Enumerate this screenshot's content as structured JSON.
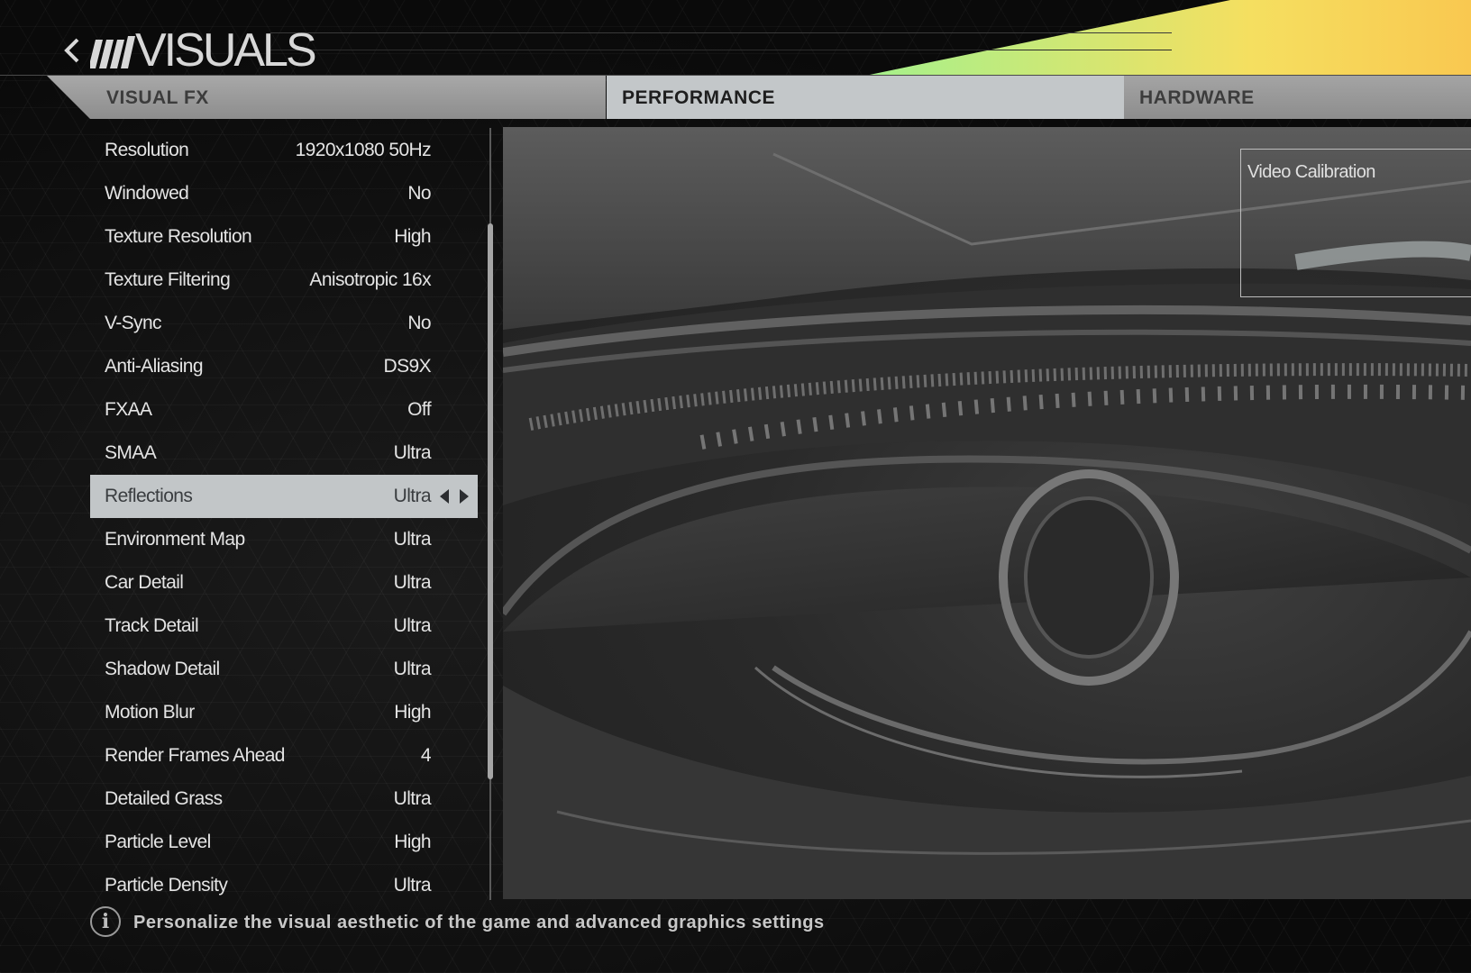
{
  "header": {
    "title": "VISUALS",
    "accent_gradient": [
      "#e0306a",
      "#3ef0a0",
      "#f9c850"
    ]
  },
  "tabs": [
    {
      "label": "VISUAL FX",
      "active": false
    },
    {
      "label": "PERFORMANCE",
      "active": true
    },
    {
      "label": "HARDWARE",
      "active": false
    }
  ],
  "settings": [
    {
      "label": "Resolution",
      "value": "1920x1080 50Hz"
    },
    {
      "label": "Windowed",
      "value": "No"
    },
    {
      "label": "Texture Resolution",
      "value": "High"
    },
    {
      "label": "Texture Filtering",
      "value": "Anisotropic 16x"
    },
    {
      "label": "V-Sync",
      "value": "No"
    },
    {
      "label": "Anti-Aliasing",
      "value": "DS9X"
    },
    {
      "label": "FXAA",
      "value": "Off"
    },
    {
      "label": "SMAA",
      "value": "Ultra"
    },
    {
      "label": "Reflections",
      "value": "Ultra",
      "selected": true
    },
    {
      "label": "Environment Map",
      "value": "Ultra"
    },
    {
      "label": "Car Detail",
      "value": "Ultra"
    },
    {
      "label": "Track Detail",
      "value": "Ultra"
    },
    {
      "label": "Shadow Detail",
      "value": "Ultra"
    },
    {
      "label": "Motion Blur",
      "value": "High"
    },
    {
      "label": "Render Frames Ahead",
      "value": "4"
    },
    {
      "label": "Detailed Grass",
      "value": "Ultra"
    },
    {
      "label": "Particle Level",
      "value": "High"
    },
    {
      "label": "Particle Density",
      "value": "Ultra"
    }
  ],
  "preview": {
    "calibration_label": "Video Calibration"
  },
  "footer": {
    "info_icon": "info-icon",
    "info_glyph": "i",
    "description": "Personalize the visual aesthetic of the game and advanced graphics settings"
  }
}
